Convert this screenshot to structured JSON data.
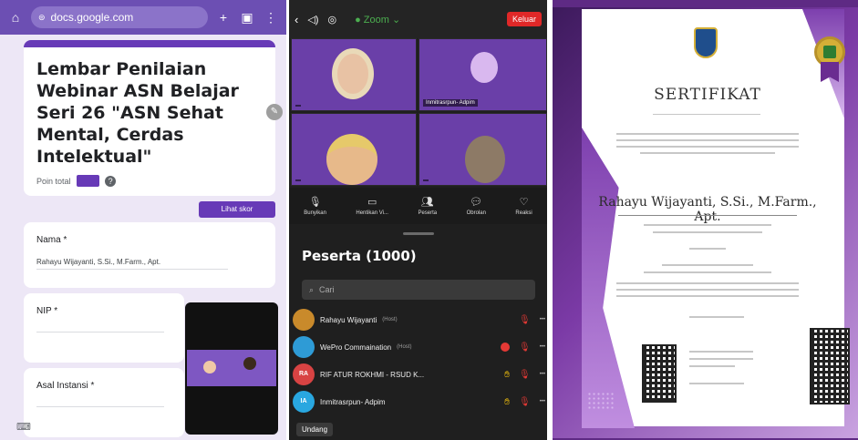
{
  "form": {
    "url": "docs.google.com",
    "title": "Lembar Penilaian Webinar ASN Belajar Seri 26 \"ASN Sehat Mental, Cerdas Intelektual\"",
    "points_label": "Poin total",
    "view_score_button": "Lihat skor",
    "questions": [
      {
        "label": "Nama *",
        "answer": "Rahayu Wijayanti, S.Si., M.Farm., Apt."
      },
      {
        "label": "NIP *",
        "answer": ""
      },
      {
        "label": "Asal Instansi *",
        "answer": ""
      }
    ]
  },
  "zoom": {
    "app_label": "Zoom",
    "leave_label": "Keluar",
    "tiles": [
      {
        "name": ""
      },
      {
        "name": "Inmitrasrpun- Adpim"
      },
      {
        "name": ""
      },
      {
        "name": ""
      }
    ],
    "toolbar": [
      {
        "label": "Bunyikan",
        "icon": "mic-icon"
      },
      {
        "label": "Hentikan Vi...",
        "icon": "video-icon"
      },
      {
        "label": "Peserta",
        "icon": "participants-icon"
      },
      {
        "label": "Obrolan",
        "icon": "chat-icon"
      },
      {
        "label": "Reaksi",
        "icon": "heart-icon"
      }
    ],
    "participants_title": "Peserta (1000)",
    "search_placeholder": "Cari",
    "participants": [
      {
        "name": "Rahayu Wijayanti",
        "tag": "(Host)",
        "initials": "",
        "color": "#c98a2b",
        "hand": false,
        "cam_off": false
      },
      {
        "name": "WePro Commaination",
        "tag": "(Host)",
        "initials": "",
        "color": "#2e9bd6",
        "hand": false,
        "cam_off": true
      },
      {
        "name": "RIF ATUR ROKHMI - RSUD K...",
        "tag": "",
        "initials": "RA",
        "color": "#d84343",
        "hand": true,
        "cam_off": false
      },
      {
        "name": "Inmitrasrpun- Adpim",
        "tag": "",
        "initials": "IA",
        "color": "#29a7e0",
        "hand": true,
        "cam_off": false
      }
    ],
    "invite_label": "Undang"
  },
  "certificate": {
    "title": "SERTIFIKAT",
    "recipient": "Rahayu Wijayanti, S.Si., M.Farm., Apt."
  }
}
